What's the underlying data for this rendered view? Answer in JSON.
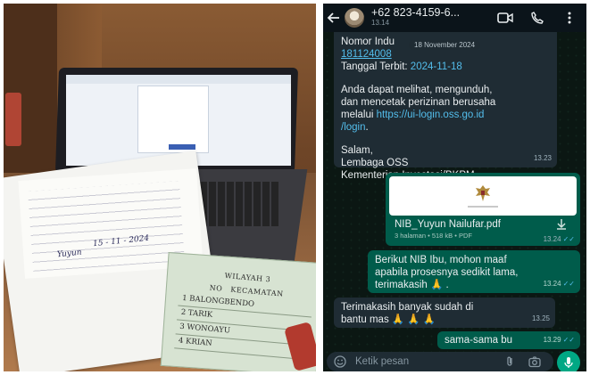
{
  "photo": {
    "handwriting_1": "15 - 11 - 2024",
    "handwriting_2": "Yuyun",
    "table_header_1": "WILAYAH 3",
    "table_header_2": "KECAMATAN",
    "table_no_label": "NO",
    "table_rows": [
      {
        "no": "1",
        "name": "BALONGBENDO"
      },
      {
        "no": "2",
        "name": "TARIK"
      },
      {
        "no": "3",
        "name": "WONOAYU"
      },
      {
        "no": "4",
        "name": "KRIAN"
      }
    ]
  },
  "chat": {
    "contact_name": "+62 823-4159-6...",
    "contact_status": "13.14",
    "date_chip": "18 November 2024",
    "msg1": {
      "line_nomor": "Nomor Indu",
      "nomor_value": "181124008",
      "line_tanggal_label": "Tanggal Terbit: ",
      "tanggal_value": "2024-11-18",
      "body_1": "Anda dapat melihat, mengunduh,",
      "body_2": "dan mencetak perizinan berusaha",
      "body_3_prefix": "melalui ",
      "link_1": "https://ui-login.oss.go.id",
      "link_2": "/login",
      "body_3_suffix": ".",
      "salam": "Salam,",
      "sig_1": "Lembaga OSS",
      "sig_2": "Kementerian Investasi/BKPM",
      "time": "13.23"
    },
    "doc": {
      "name": "NIB_Yuyun Nailufar.pdf",
      "meta": "3 halaman • 518 kB • PDF",
      "time": "13.24",
      "ticks": "✓✓"
    },
    "msg2": {
      "line_1": "Berikut NIB Ibu, mohon maaf",
      "line_2": "apabila prosesnya sedikit lama,",
      "line_3": "terimakasih 🙏 .",
      "time": "13.24",
      "ticks": "✓✓"
    },
    "msg3": {
      "line_1": "Terimakasih banyak sudah di",
      "line_2": "bantu mas 🙏 🙏 🙏",
      "time": "13.25"
    },
    "msg4": {
      "text": "sama-sama bu",
      "time": "13.29",
      "ticks": "✓✓"
    },
    "input_placeholder": "Ketik pesan"
  },
  "colors": {
    "header_bg": "#0b141a",
    "incoming_bubble": "#1f2c34",
    "outgoing_bubble": "#005c4b",
    "accent_green": "#00a884",
    "link_blue": "#53bdeb"
  },
  "icons": [
    "back-arrow-icon",
    "video-call-icon",
    "phone-icon",
    "menu-dots-icon",
    "download-icon",
    "emoji-icon",
    "attach-icon",
    "camera-icon",
    "mic-icon"
  ]
}
